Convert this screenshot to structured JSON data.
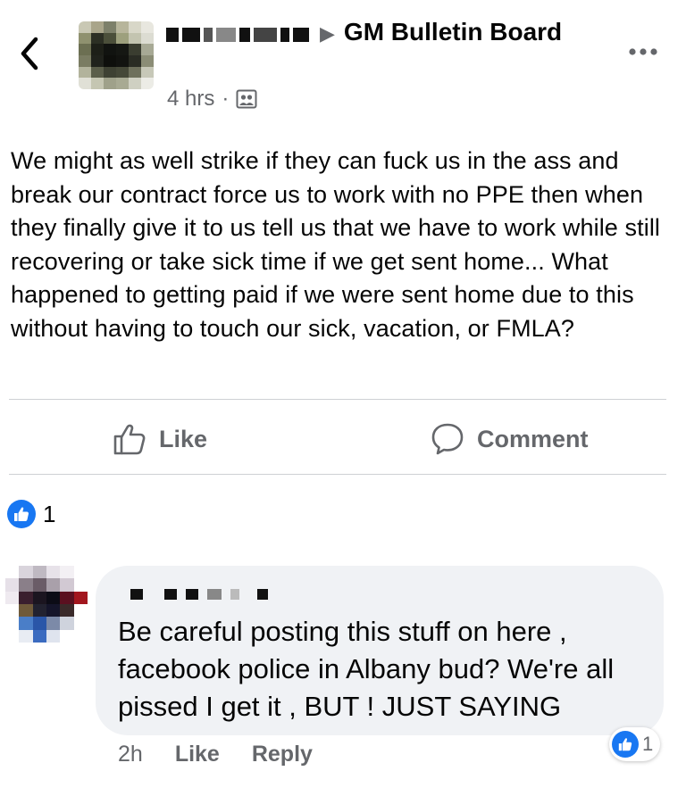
{
  "post": {
    "group": "GM Bulletin Board",
    "time": "4 hrs",
    "separator": "·",
    "text": "We might as well strike if they can fuck us in the ass and break our contract force us to work with no PPE then when they finally give it to us tell us that we have to work while still recovering or take sick time if we get sent home... What happened to getting paid if we were sent home due to this without having to touch our sick, vacation, or FMLA?"
  },
  "actions": {
    "like_label": "Like",
    "comment_label": "Comment"
  },
  "reactions": {
    "count": "1"
  },
  "comment": {
    "text": "Be careful posting this stuff on here , facebook police in Albany bud? We're all pissed I get it , BUT !  JUST SAYING",
    "time": "2h",
    "like_label": "Like",
    "reply_label": "Reply",
    "reaction_count": "1"
  },
  "colors": {
    "brand_blue": "#1877f2",
    "secondary_text": "#65676b",
    "bubble_bg": "#f0f2f5",
    "divider": "#ced0d4"
  },
  "icons": [
    "back-chevron-icon",
    "more-options-icon",
    "group-audience-icon",
    "like-thumb-icon",
    "comment-bubble-icon",
    "like-reaction-icon"
  ]
}
